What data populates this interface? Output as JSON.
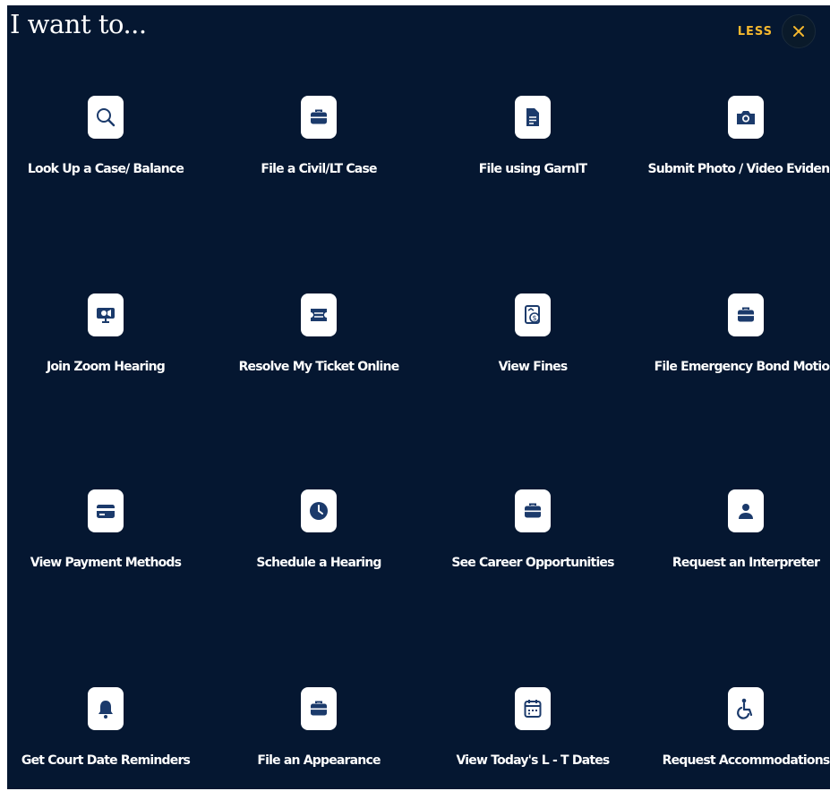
{
  "heading": "I want to...",
  "less_label": "LESS",
  "colors": {
    "background": "#051731",
    "accent": "#f5b82e",
    "icon": "#1b3a6b",
    "tile": "#ffffff"
  },
  "items": [
    {
      "label": "Look Up a Case/ Balance",
      "icon": "search-icon"
    },
    {
      "label": "File a Civil/LT Case",
      "icon": "briefcase-icon"
    },
    {
      "label": "File using GarnIT",
      "icon": "document-icon"
    },
    {
      "label": "Submit Photo / Video Evidence",
      "icon": "camera-icon"
    },
    {
      "label": "Join Zoom Hearing",
      "icon": "video-monitor-icon"
    },
    {
      "label": "Resolve My Ticket Online",
      "icon": "ticket-icon"
    },
    {
      "label": "View Fines",
      "icon": "money-document-icon"
    },
    {
      "label": "File Emergency Bond Motion",
      "icon": "briefcase-icon"
    },
    {
      "label": "View Payment Methods",
      "icon": "credit-card-icon"
    },
    {
      "label": "Schedule a Hearing",
      "icon": "clock-icon"
    },
    {
      "label": "See Career Opportunities",
      "icon": "briefcase-icon"
    },
    {
      "label": "Request an Interpreter",
      "icon": "person-icon"
    },
    {
      "label": "Get Court Date Reminders",
      "icon": "bell-icon"
    },
    {
      "label": "File an Appearance",
      "icon": "briefcase-icon"
    },
    {
      "label": "View Today's L - T Dates",
      "icon": "calendar-icon"
    },
    {
      "label": "Request Accommodations",
      "icon": "wheelchair-icon"
    }
  ]
}
